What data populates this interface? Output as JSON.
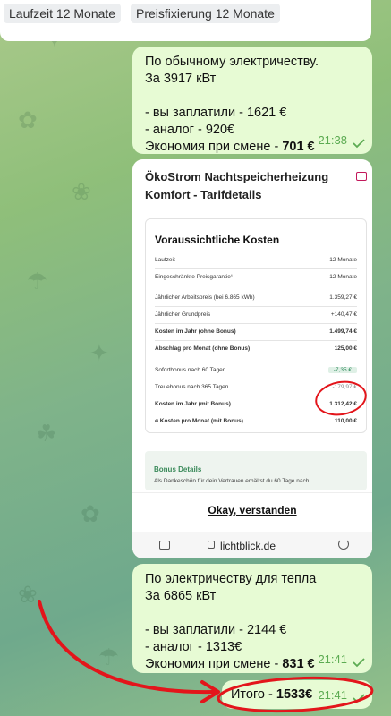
{
  "top_card": {
    "tags": [
      "Laufzeit 12 Monate",
      "Preisfixierung 12 Monate"
    ]
  },
  "message1": {
    "lines": [
      "По обычному электричеству.",
      "За 3917 кВт",
      "",
      "- вы заплатили - 1621 €",
      "- аналог - 920€"
    ],
    "savings_label": "Экономия при смене - ",
    "savings_value": "701 €",
    "time": "21:38"
  },
  "screenshot": {
    "header": "ÖkoStrom Nachtspeicherheizung Komfort - Tarifdetails",
    "cost_title": "Voraussichtliche Kosten",
    "rows": [
      {
        "label": "Laufzeit",
        "value": "12 Monate"
      },
      {
        "label": "Eingeschränkte Preisgarantie¹",
        "value": "12 Monate"
      },
      {
        "label": "Jährlicher Arbeitspreis (bei 6.865 kWh)",
        "value": "1.359,27 €"
      },
      {
        "label": "Jährlicher Grundpreis",
        "value": "+140,47 €"
      },
      {
        "label": "Kosten im Jahr (ohne Bonus)",
        "value": "1.499,74 €"
      },
      {
        "label": "Abschlag pro Monat (ohne Bonus)",
        "value": "125,00 €"
      },
      {
        "label": "Sofortbonus nach 60 Tagen",
        "value": "-7,35 €"
      },
      {
        "label": "Treuebonus nach 365 Tagen",
        "value": "-179,97 €"
      },
      {
        "label": "Kosten im Jahr (mit Bonus)",
        "value": "1.312,42 €"
      },
      {
        "label": "ø Kosten pro Monat (mit Bonus)",
        "value": "110,00 €"
      }
    ],
    "bonus_title": "Bonus Details",
    "bonus_text": "Als Dankeschön für dein Vertrauen erhältst du 60 Tage nach",
    "okay_button": "Okay, verstanden",
    "url": "lichtblick.de"
  },
  "message2": {
    "lines": [
      "По электричеству для тепла",
      "За 6865 кВт",
      "",
      "- вы заплатили - 2144 €",
      "- аналог - 1313€"
    ],
    "savings_label": "Экономия при смене - ",
    "savings_value": "831 €",
    "time": "21:41"
  },
  "message3": {
    "label": "Итого - ",
    "value": "1533€",
    "time": "21:41"
  },
  "colors": {
    "bubble": "#e7fbd4",
    "time_green": "#5cab52",
    "annotation_red": "#e3151b"
  }
}
